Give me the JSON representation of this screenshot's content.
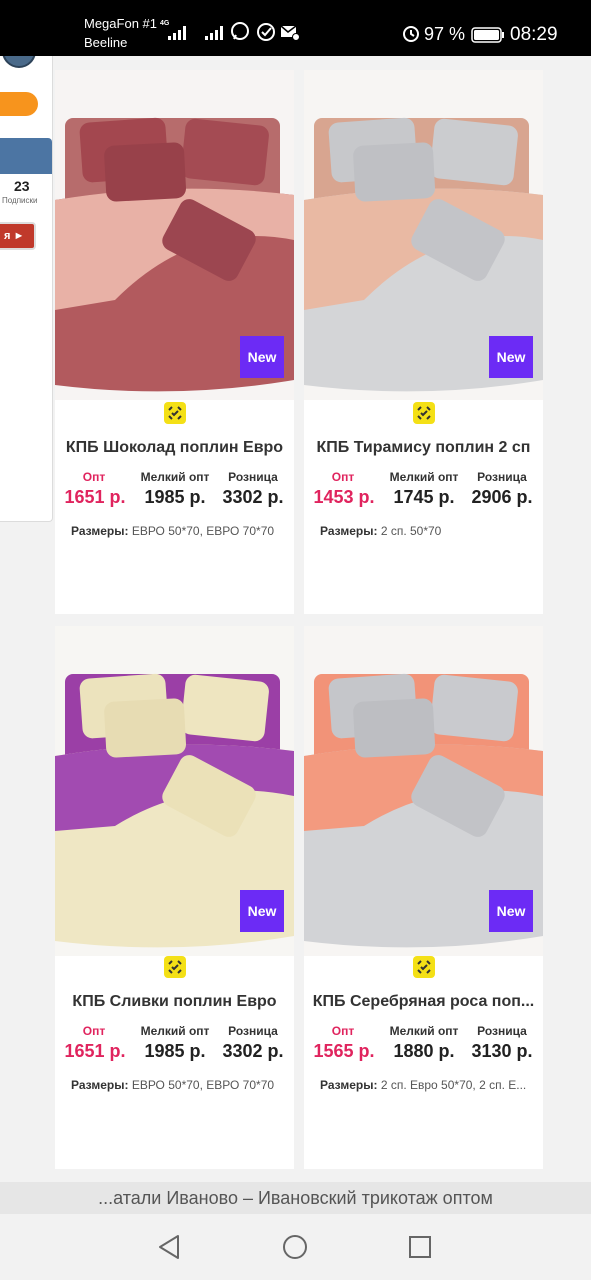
{
  "status_bar": {
    "carrier1": "MegaFon #1",
    "carrier2": "Beeline",
    "network_type": "4G",
    "battery_percent": "97 %",
    "time": "08:29",
    "icons": [
      "signal-icon",
      "signal-icon",
      "viber-icon",
      "sberbank-icon",
      "mail-settings-icon",
      "alarm-icon",
      "battery-icon"
    ]
  },
  "left_panel": {
    "count": "23",
    "count_label": "Подписки",
    "red_button": "я ►"
  },
  "colors": {
    "price_accent": "#e0245e",
    "new_badge": "#6c2bf5",
    "compare_icon": "#f4e016"
  },
  "price_labels": {
    "opt": "Опт",
    "small_opt": "Мелкий опт",
    "retail": "Розница"
  },
  "sizes_label": "Размеры:",
  "products": [
    {
      "badge": "New",
      "title": "КПБ Шоколад поплин Евро",
      "opt": "1651 р.",
      "small_opt": "1985 р.",
      "retail": "3302 р.",
      "sizes": "ЕВРО 50*70, ЕВРО 70*70"
    },
    {
      "badge": "New",
      "title": "КПБ Тирамису поплин 2 сп",
      "opt": "1453 р.",
      "small_opt": "1745 р.",
      "retail": "2906 р.",
      "sizes": "2 сп. 50*70"
    },
    {
      "badge": "New",
      "title": "КПБ Сливки поплин Евро",
      "opt": "1651 р.",
      "small_opt": "1985 р.",
      "retail": "3302 р.",
      "sizes": "ЕВРО 50*70, ЕВРО 70*70"
    },
    {
      "badge": "New",
      "title": "КПБ Серебряная роса поп...",
      "opt": "1565 р.",
      "small_opt": "1880 р.",
      "retail": "3130 р.",
      "sizes": "2 сп. Евро 50*70, 2 сп. Е..."
    }
  ],
  "url_bar": "...атали Иваново – Ивановский трикотаж оптом",
  "nav": {
    "icons": [
      "back-icon",
      "home-icon",
      "recents-icon"
    ]
  }
}
